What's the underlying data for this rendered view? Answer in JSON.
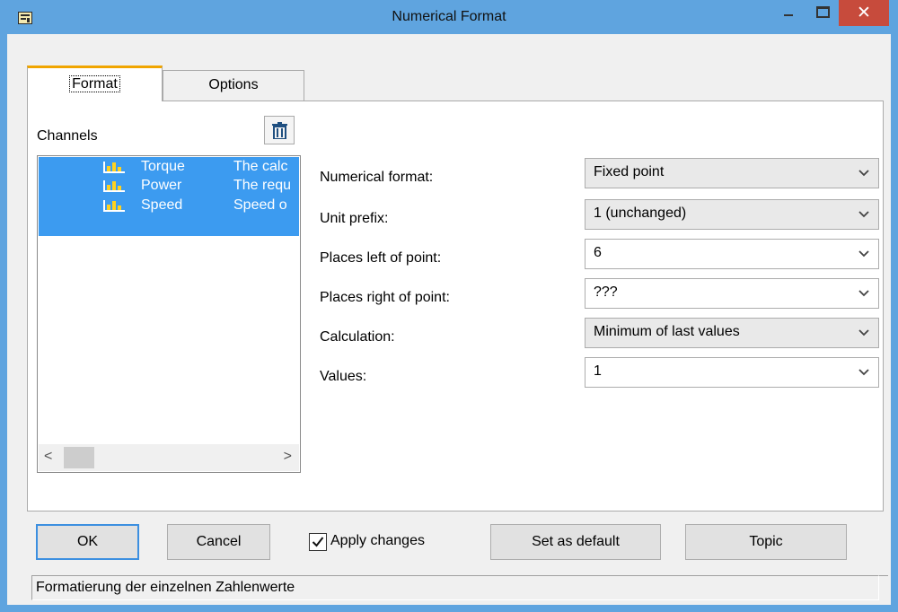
{
  "window": {
    "title": "Numerical Format",
    "close_glyph": "✕"
  },
  "tabs": [
    {
      "label": "Format",
      "active": true
    },
    {
      "label": "Options",
      "active": false
    }
  ],
  "channels": {
    "label": "Channels",
    "delete_icon": "trash-icon",
    "items": [
      {
        "name": "Torque",
        "description": "The calc"
      },
      {
        "name": "Power",
        "description": "The requ"
      },
      {
        "name": "Speed",
        "description": "Speed o"
      }
    ],
    "scroll_left": "<",
    "scroll_right": ">"
  },
  "fields": [
    {
      "label": "Numerical format:",
      "value": "Fixed point",
      "kind": "dropdown"
    },
    {
      "label": "Unit prefix:",
      "value": "1 (unchanged)",
      "kind": "dropdown"
    },
    {
      "label": "Places left of point:",
      "value": "6",
      "kind": "editable"
    },
    {
      "label": "Places right of point:",
      "value": "???",
      "kind": "editable"
    },
    {
      "label": "Calculation:",
      "value": "Minimum of last values",
      "kind": "dropdown"
    },
    {
      "label": "Values:",
      "value": "1",
      "kind": "editable"
    }
  ],
  "buttons": {
    "ok": "OK",
    "cancel": "Cancel",
    "apply_changes": "Apply changes",
    "apply_checked": true,
    "set_default": "Set as default",
    "topic": "Topic"
  },
  "status": {
    "text": "Formatierung der einzelnen Zahlenwerte"
  },
  "colors": {
    "titlebar": "#5fa4df",
    "close": "#c74b3c",
    "selection": "#3c9bf0",
    "active_tab_accent": "#f0a500",
    "default_button_border": "#3c8fe0"
  }
}
